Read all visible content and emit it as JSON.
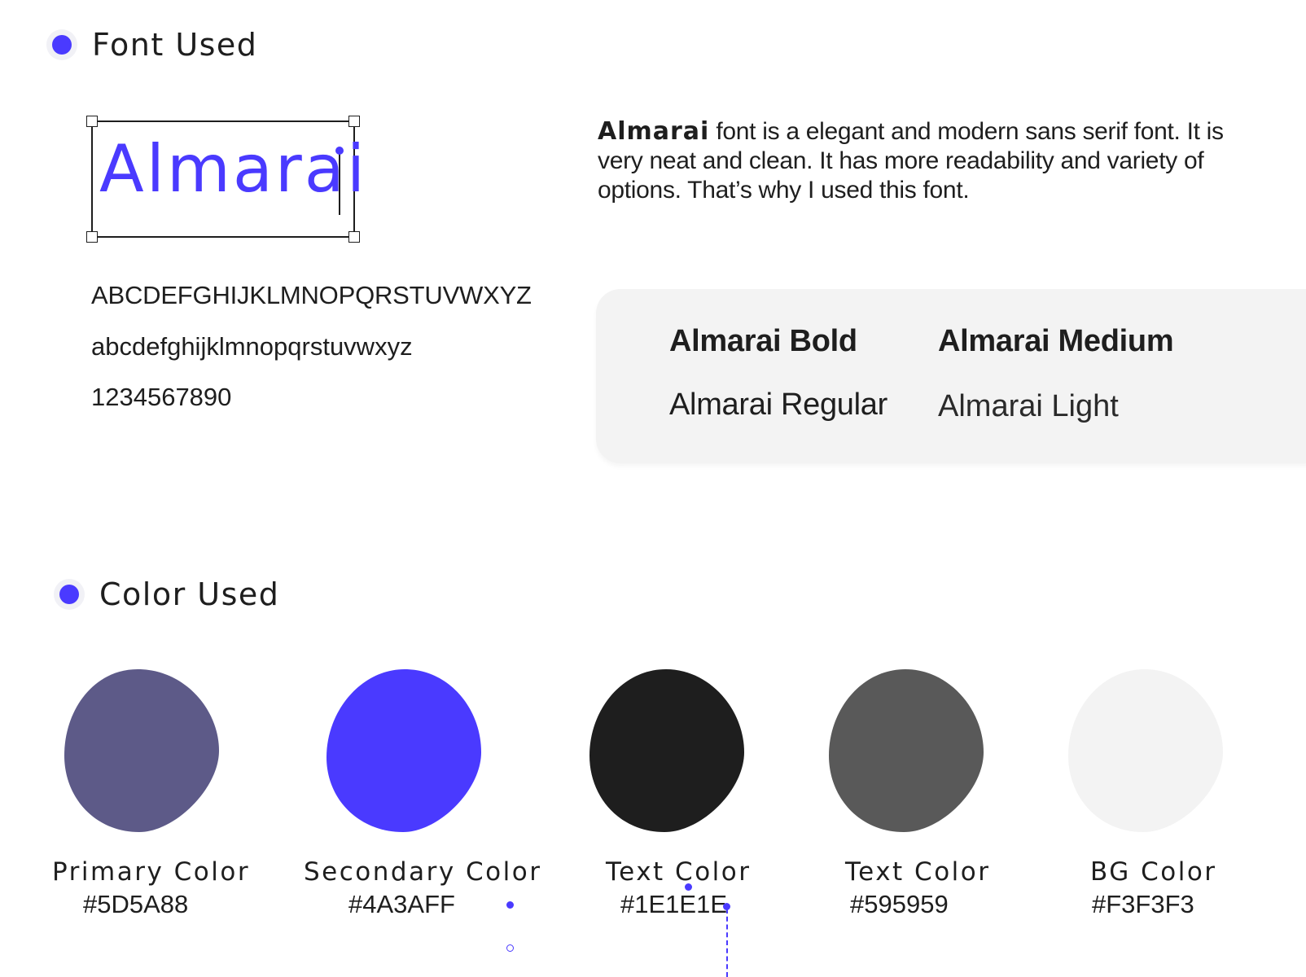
{
  "font_section": {
    "title": "Font Used",
    "specimen": "Almarai",
    "uppercase": "ABCDEFGHIJKLMNOPQRSTUVWXYZ",
    "lowercase": "abcdefghijklmnopqrstuvwxyz",
    "digits": "1234567890",
    "description_name": "Almarai",
    "description_text": " font is a elegant and modern sans serif font. It is very neat and clean. It has more readability and variety of options. That’s why I used this font.",
    "weights": {
      "bold": "Almarai Bold",
      "medium": "Almarai Medium",
      "regular": "Almarai Regular",
      "light": "Almarai Light"
    }
  },
  "color_section": {
    "title": "Color Used",
    "swatches": [
      {
        "label": "Primary Color",
        "hex": "#5D5A88",
        "color": "#5D5A88"
      },
      {
        "label": "Secondary Color",
        "hex": "#4A3AFF",
        "color": "#4A3AFF"
      },
      {
        "label": "Text Color",
        "hex": "#1E1E1E",
        "color": "#1E1E1E"
      },
      {
        "label": "Text Color",
        "hex": "#595959",
        "color": "#595959"
      },
      {
        "label": "BG Color",
        "hex": "#F3F3F3",
        "color": "#F3F3F3"
      }
    ]
  },
  "colors": {
    "accent": "#4A3AFF",
    "card_bg": "#F3F3F3"
  }
}
